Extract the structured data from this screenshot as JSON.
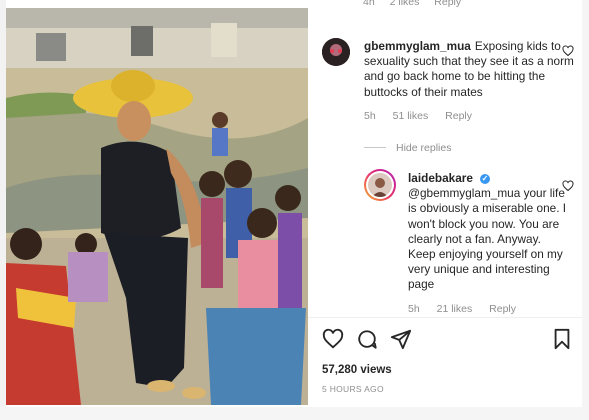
{
  "post_photo": {
    "alt": "Photo of a woman in a wide-brimmed yellow hat with a group of children"
  },
  "top_comment_meta": {
    "time": "4h",
    "likes": "2 likes",
    "reply": "Reply"
  },
  "comments": [
    {
      "username": "gbemmyglam_mua",
      "text": "Exposing kids to sexuality such that they see it as a norm and go back home to be hitting the buttocks of their mates",
      "time": "5h",
      "likes": "51 likes",
      "reply": "Reply"
    }
  ],
  "hide_replies": "Hide replies",
  "reply": {
    "username": "laidebakare",
    "mention": "@gbemmyglam_mua",
    "text": "your life is obviously a miserable one. I won't block you now. You are clearly not a fan. Anyway. Keep enjoying yourself on my very unique and interesting page",
    "time": "5h",
    "likes": "21 likes",
    "reply": "Reply"
  },
  "icons": {
    "like": "heart-icon",
    "comment": "comment-icon",
    "share": "send-icon",
    "save": "bookmark-icon",
    "verified": "verified-badge-icon"
  },
  "stats": {
    "views": "57,280 views",
    "time_ago": "5 HOURS AGO"
  },
  "colors": {
    "verified": "#3897f0",
    "muted": "#8e8e8e",
    "text": "#262626"
  }
}
